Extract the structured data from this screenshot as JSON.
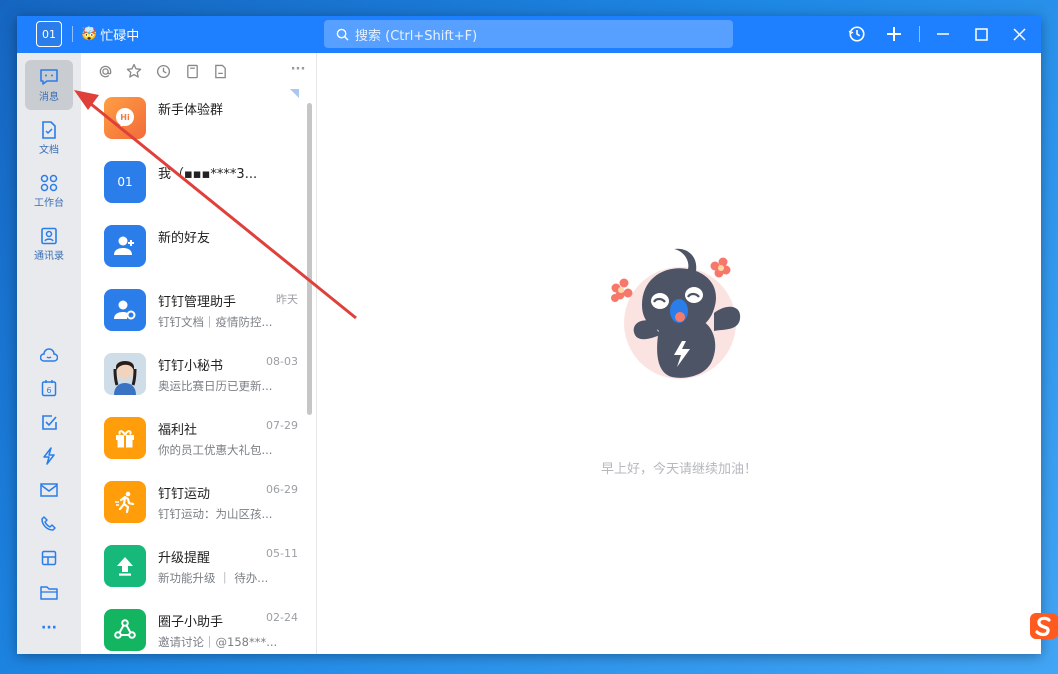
{
  "titlebar": {
    "avatar_text": "01",
    "status_text": "忙碌中",
    "search_placeholder": "搜索 (Ctrl+Shift+F)"
  },
  "nav": {
    "items": [
      {
        "label": "消息",
        "icon": "message-icon"
      },
      {
        "label": "文档",
        "icon": "document-icon"
      },
      {
        "label": "工作台",
        "icon": "workbench-icon"
      },
      {
        "label": "通讯录",
        "icon": "contacts-icon"
      }
    ],
    "more_label": "···"
  },
  "list": {
    "rows": [
      {
        "name": "新手体验群",
        "time": "",
        "preview": ""
      },
      {
        "name": "我（▪▪▪****3...",
        "time": "",
        "preview": ""
      },
      {
        "name": "新的好友",
        "time": "",
        "preview": ""
      },
      {
        "name": "钉钉管理助手",
        "time": "昨天",
        "preview": "钉钉文档｜疫情防控..."
      },
      {
        "name": "钉钉小秘书",
        "time": "08-03",
        "preview": "奥运比赛日历已更新..."
      },
      {
        "name": "福利社",
        "time": "07-29",
        "preview": "你的员工优惠大礼包..."
      },
      {
        "name": "钉钉运动",
        "time": "06-29",
        "preview": "钉钉运动：为山区孩..."
      },
      {
        "name": "升级提醒",
        "time": "05-11",
        "preview": "新功能升级 ｜ 待办..."
      },
      {
        "name": "圈子小助手",
        "time": "02-24",
        "preview": "邀请讨论｜@158***..."
      }
    ],
    "self_avatar_text": "01",
    "more_label": "···"
  },
  "main": {
    "greeting": "早上好，今天请继续加油！"
  },
  "colors": {
    "brand": "#1f80ff",
    "nav_bg": "#e8eaed",
    "arrow": "#e0403a"
  }
}
